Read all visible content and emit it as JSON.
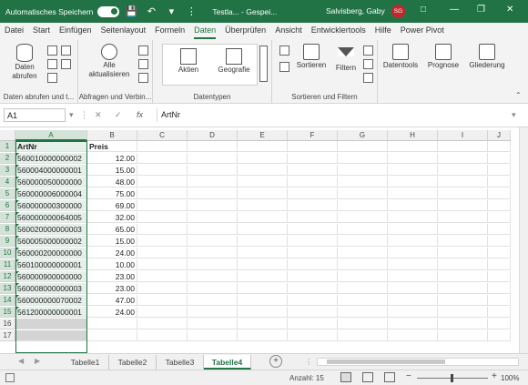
{
  "titlebar": {
    "autosave_label": "Automatisches Speichern",
    "doc_title": "Testla... - Gespei...",
    "user_name": "Salvisberg, Gaby",
    "user_initials": "SG"
  },
  "tabs": [
    "Datei",
    "Start",
    "Einfügen",
    "Seitenlayout",
    "Formeln",
    "Daten",
    "Überprüfen",
    "Ansicht",
    "Entwicklertools",
    "Hilfe",
    "Power Pivot"
  ],
  "active_tab": "Daten",
  "ribbon": {
    "get_data_label": "Daten abrufen",
    "group1_label": "Daten abrufen und t...",
    "refresh_all_label": "Alle aktualisieren",
    "group2_label": "Abfragen und Verbin...",
    "stocks_label": "Aktien",
    "geography_label": "Geografie",
    "group3_label": "Datentypen",
    "sort_label": "Sortieren",
    "filter_label": "Filtern",
    "group4_label": "Sortieren und Filtern",
    "datatools_label": "Datentools",
    "forecast_label": "Prognose",
    "outline_label": "Gliederung"
  },
  "formula_bar": {
    "name_box": "A1",
    "fx": "fx",
    "content": "ArtNr"
  },
  "grid": {
    "columns": [
      "A",
      "B",
      "C",
      "D",
      "E",
      "F",
      "G",
      "H",
      "I",
      "J"
    ],
    "rows": [
      "1",
      "2",
      "3",
      "4",
      "5",
      "6",
      "7",
      "8",
      "9",
      "10",
      "11",
      "12",
      "13",
      "14",
      "15",
      "16",
      "17"
    ],
    "header_a": "ArtNr",
    "header_b": "Preis",
    "data": [
      [
        "560010000000002",
        "12.00"
      ],
      [
        "560004000000001",
        "15.00"
      ],
      [
        "560000050000000",
        "48.00"
      ],
      [
        "560000006000004",
        "75.00"
      ],
      [
        "560000000300000",
        "69.00"
      ],
      [
        "560000000064005",
        "32.00"
      ],
      [
        "560020000000003",
        "65.00"
      ],
      [
        "560005000000002",
        "15.00"
      ],
      [
        "560000200000000",
        "24.00"
      ],
      [
        "560100000000001",
        "10.00"
      ],
      [
        "560000900000000",
        "23.00"
      ],
      [
        "560008000000003",
        "23.00"
      ],
      [
        "560000000070002",
        "47.00"
      ],
      [
        "561200000000001",
        "24.00"
      ]
    ]
  },
  "sheets": [
    "Tabelle1",
    "Tabelle2",
    "Tabelle3",
    "Tabelle4"
  ],
  "active_sheet": "Tabelle4",
  "status": {
    "count_label": "Anzahl: 15",
    "zoom": "100%"
  },
  "colors": {
    "accent": "#217346"
  }
}
